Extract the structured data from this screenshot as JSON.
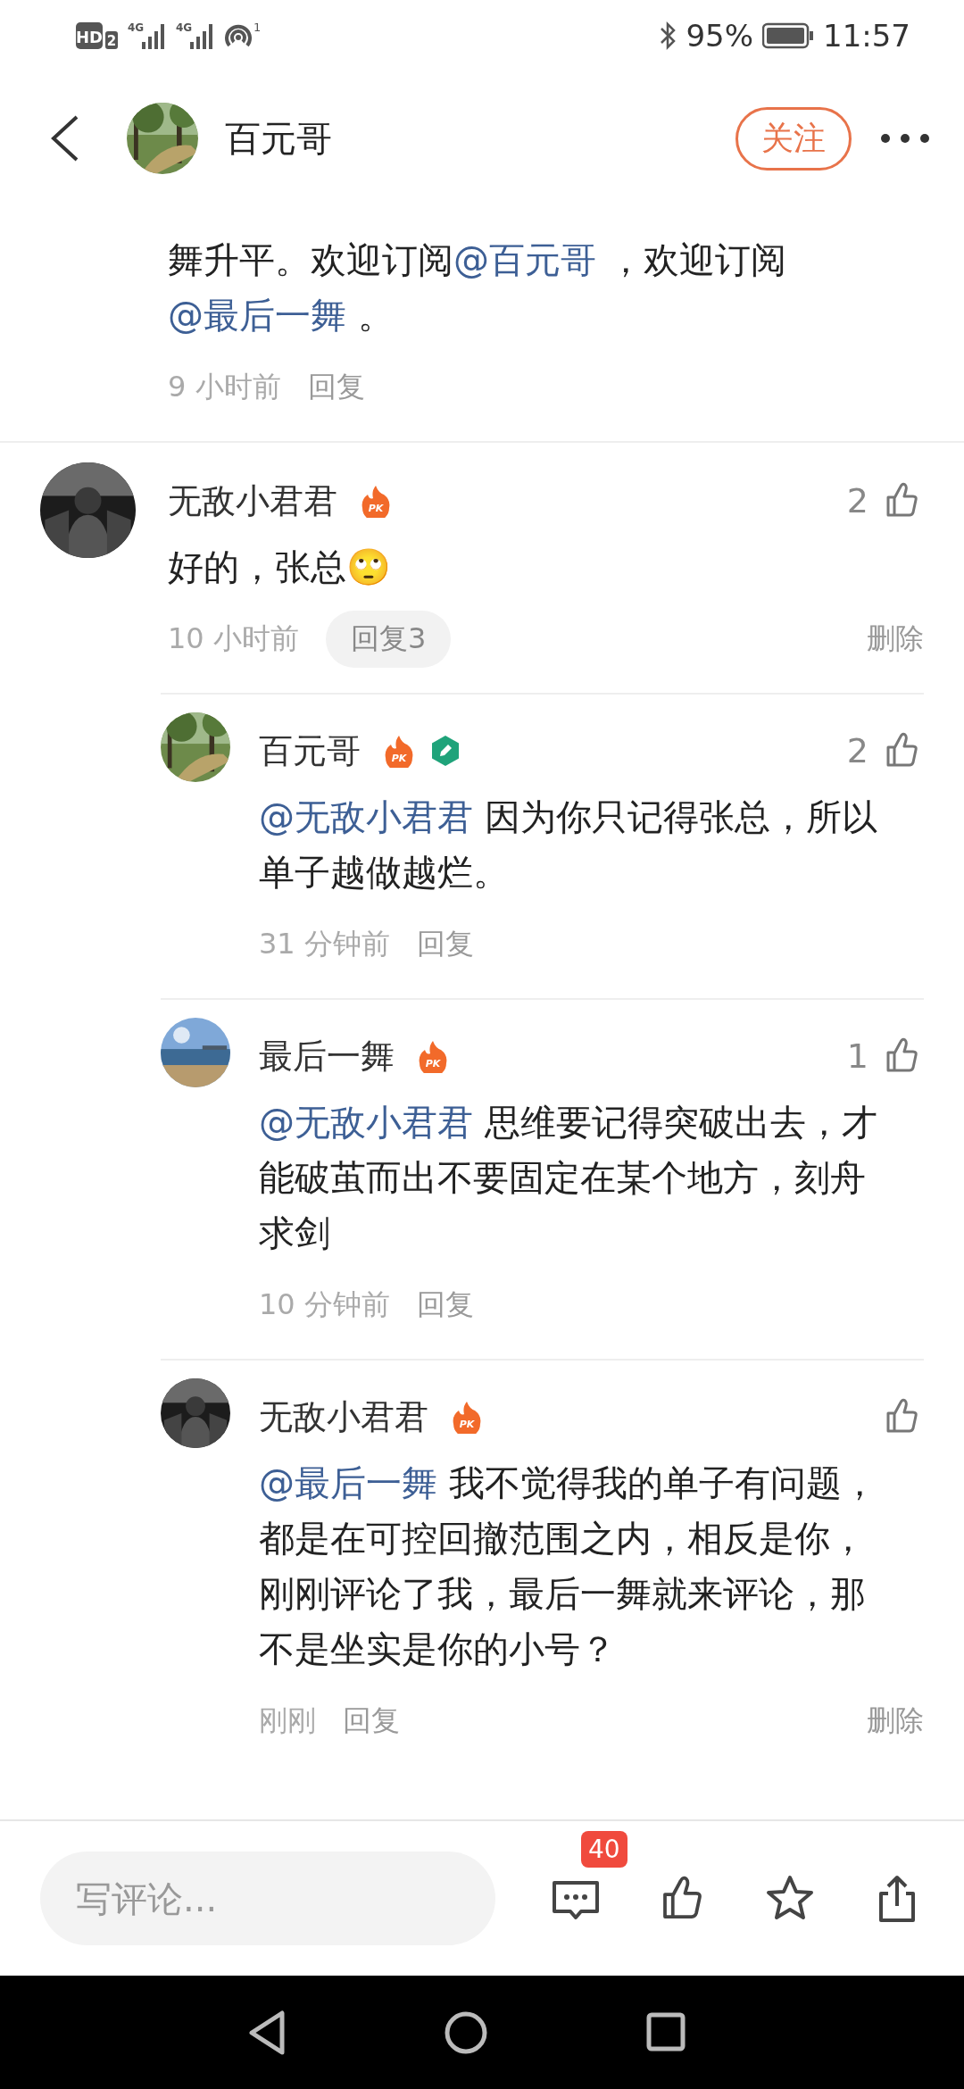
{
  "status_bar": {
    "hd": "HD",
    "sim": "2",
    "signals": [
      "4G",
      "4G"
    ],
    "hotspot_count": "1",
    "battery": "95%",
    "time": "11:57"
  },
  "header": {
    "user": "百元哥",
    "avatar": {
      "kind": "picture"
    },
    "follow_label": "关注"
  },
  "comments": [
    {
      "kind": "partial",
      "text": [
        {
          "kind": "plain",
          "text": "舞升平。欢迎订阅"
        },
        {
          "kind": "mention",
          "text": "@百元哥"
        },
        {
          "kind": "plain",
          "text": " ，欢迎订阅"
        },
        {
          "kind": "mention",
          "text": "@最后一舞"
        },
        {
          "kind": "plain",
          "text": " 。"
        }
      ],
      "time": "9 小时前",
      "reply_label": "回复"
    },
    {
      "kind": "full",
      "user": "无敌小君君",
      "avatar": {
        "kind": "picture"
      },
      "badges": [
        {
          "kind": "pk",
          "label": "PK"
        }
      ],
      "likes": "2",
      "liked": false,
      "text": [
        {
          "kind": "plain",
          "text": "好的，张总🙄"
        }
      ],
      "time": "10 小时前",
      "reply_label": "回复3",
      "delete_label": "删除",
      "replies": [
        {
          "user": "百元哥",
          "avatar": {
            "kind": "picture"
          },
          "badges": [
            {
              "kind": "pk",
              "label": "PK"
            },
            {
              "kind": "edit"
            }
          ],
          "likes": "2",
          "liked": false,
          "text": [
            {
              "kind": "mention",
              "text": "@无敌小君君"
            },
            {
              "kind": "plain",
              "text": " 因为你只记得张总，所以单子越做越烂。"
            }
          ],
          "time": "31 分钟前",
          "reply_label": "回复"
        },
        {
          "user": "最后一舞",
          "avatar": {
            "kind": "picture"
          },
          "badges": [
            {
              "kind": "pk",
              "label": "PK"
            }
          ],
          "likes": "1",
          "liked": false,
          "text": [
            {
              "kind": "mention",
              "text": "@无敌小君君"
            },
            {
              "kind": "plain",
              "text": " 思维要记得突破出去，才能破茧而出不要固定在某个地方，刻舟求剑"
            }
          ],
          "time": "10 分钟前",
          "reply_label": "回复"
        },
        {
          "user": "无敌小君君",
          "avatar": {
            "kind": "picture"
          },
          "badges": [
            {
              "kind": "pk",
              "label": "PK"
            }
          ],
          "liked": false,
          "text": [
            {
              "kind": "mention",
              "text": "@最后一舞"
            },
            {
              "kind": "plain",
              "text": " 我不觉得我的单子有问题，都是在可控回撤范围之内，相反是你，刚刚评论了我，最后一舞就来评论，那不是坐实是你的小号？"
            }
          ],
          "time": "刚刚",
          "reply_label": "回复",
          "delete_label": "删除"
        }
      ]
    }
  ],
  "bottom_bar": {
    "placeholder": "写评论...",
    "comment_count": "40",
    "liked": false,
    "starred": false
  }
}
